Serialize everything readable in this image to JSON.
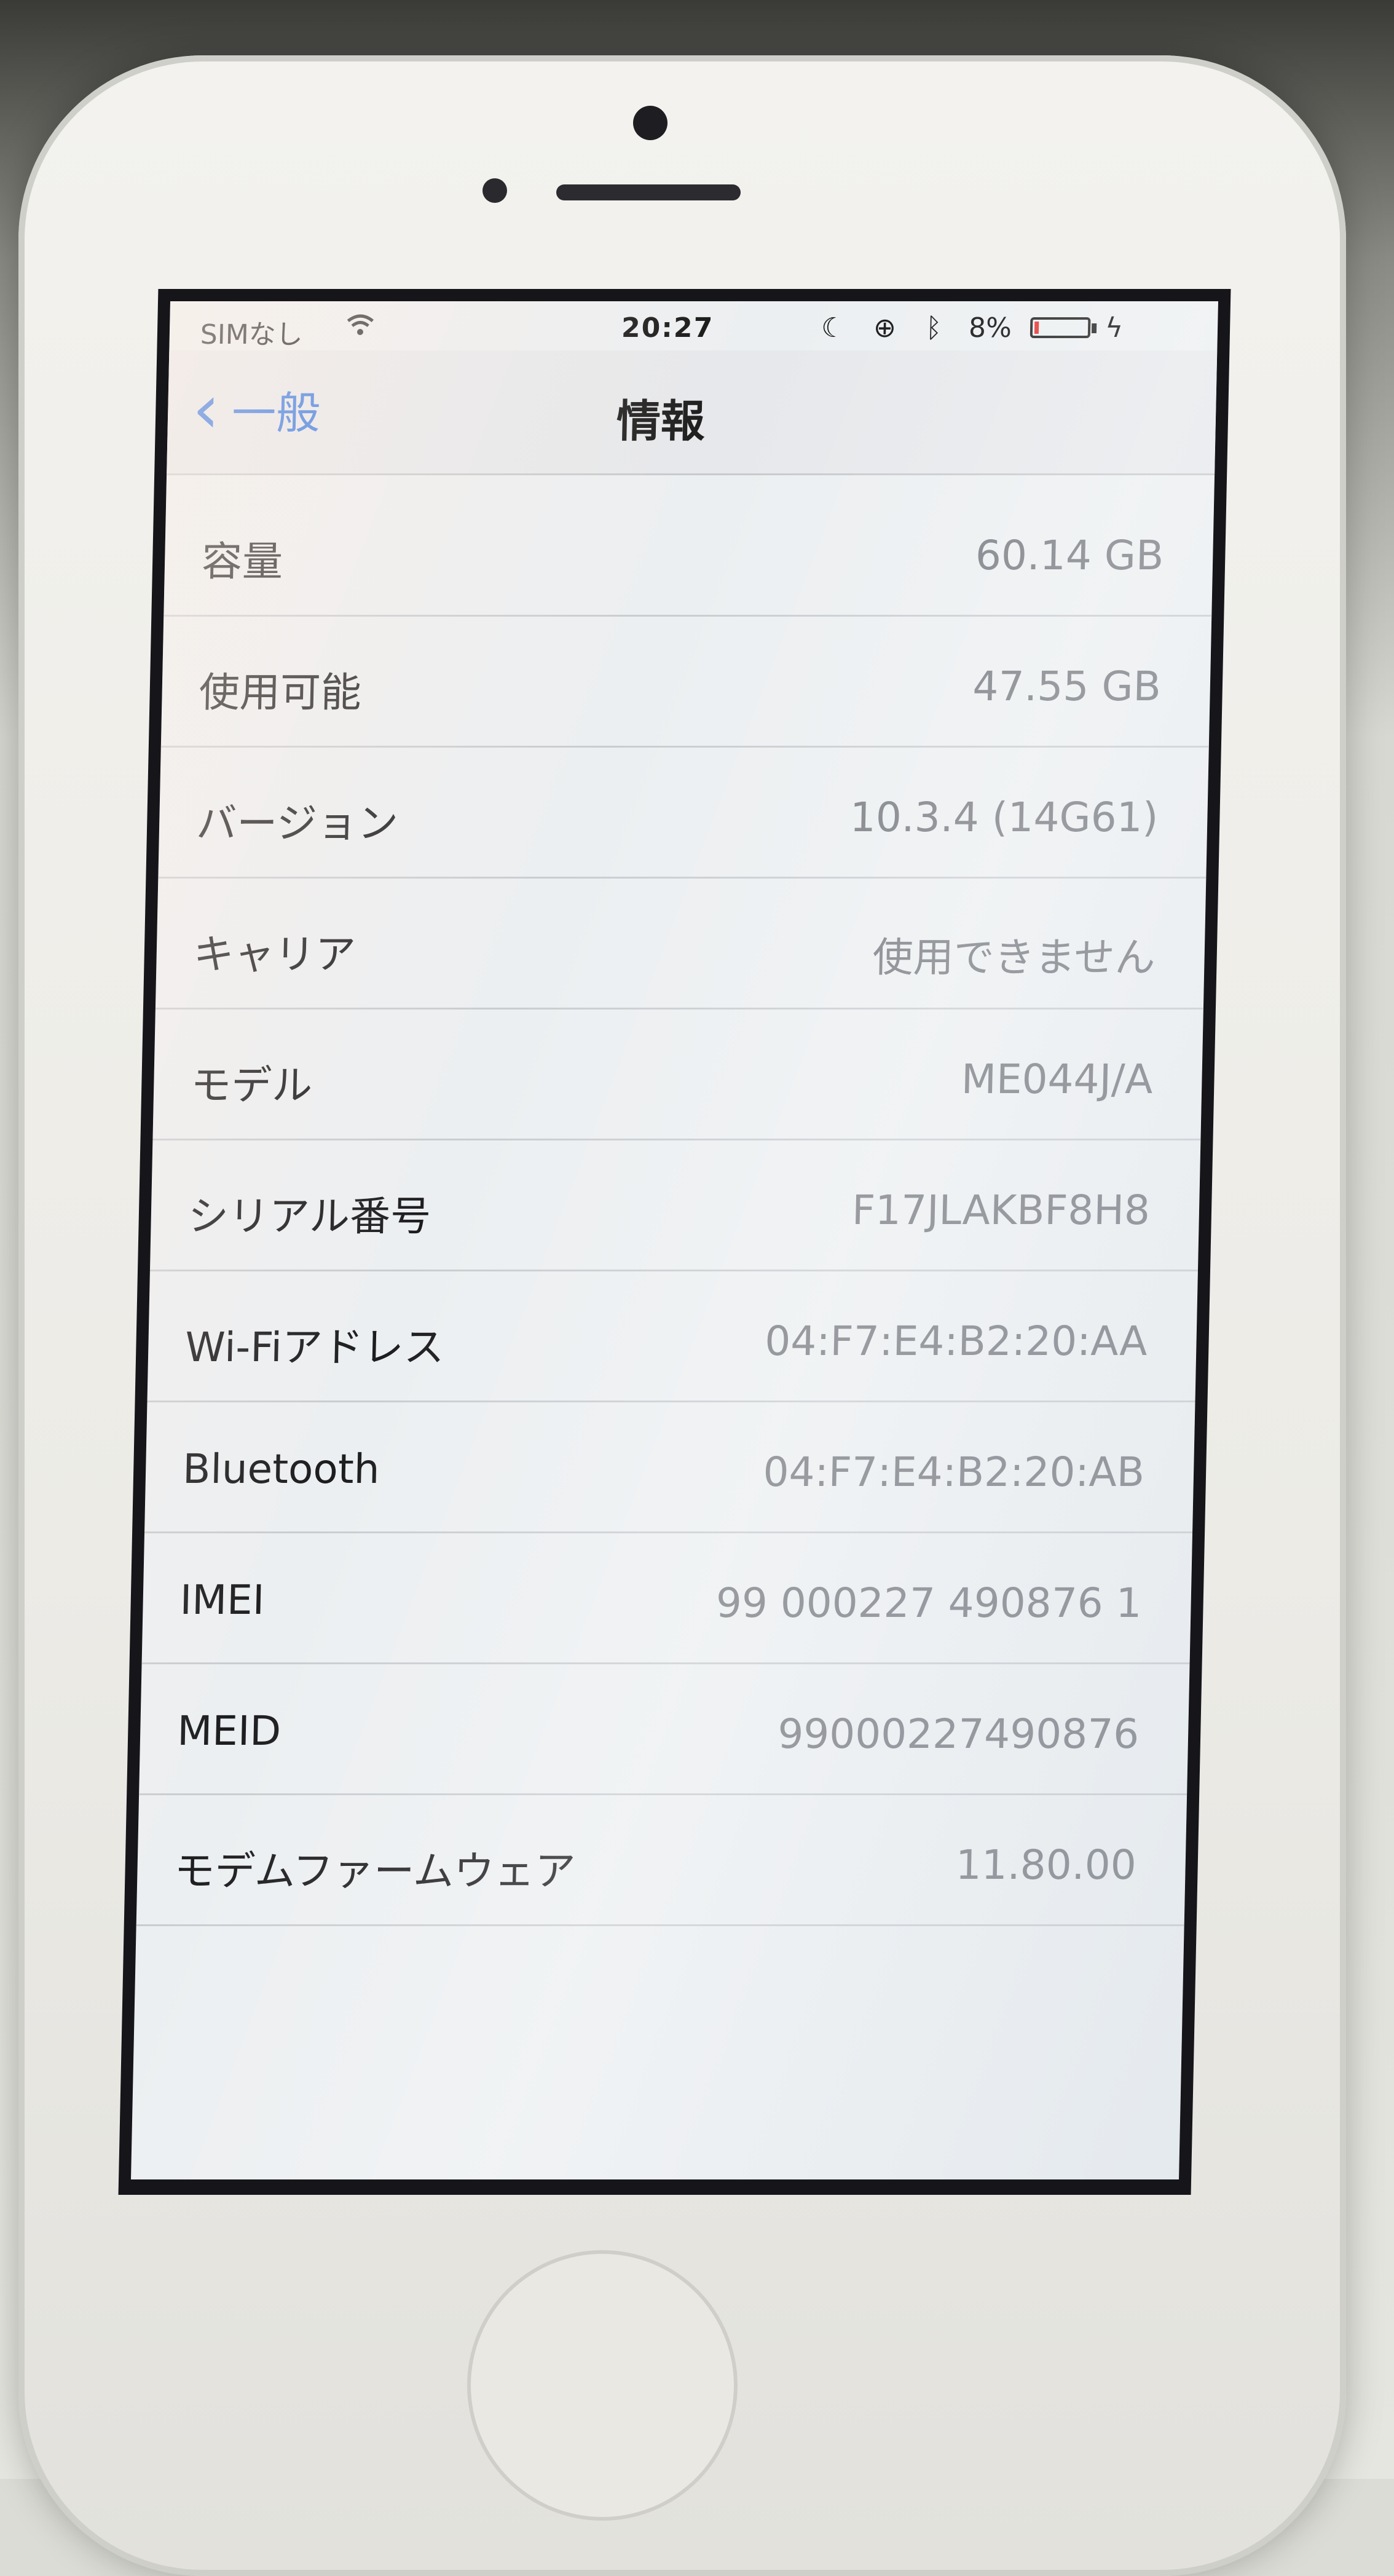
{
  "status_bar": {
    "carrier": "SIMなし",
    "time": "20:27",
    "battery_percent": "8%",
    "battery_level": 0.08,
    "icons": [
      "wifi-icon",
      "moon-icon",
      "rotation-lock-icon",
      "bluetooth-icon",
      "battery-icon",
      "charging-icon"
    ]
  },
  "nav": {
    "back_label": "一般",
    "title": "情報"
  },
  "rows": [
    {
      "label": "容量",
      "value": "60.14 GB"
    },
    {
      "label": "使用可能",
      "value": "47.55 GB"
    },
    {
      "label": "バージョン",
      "value": "10.3.4 (14G61)"
    },
    {
      "label": "キャリア",
      "value": "使用できません"
    },
    {
      "label": "モデル",
      "value": "ME044J/A"
    },
    {
      "label": "シリアル番号",
      "value": "F17JLAKBF8H8"
    },
    {
      "label": "Wi-Fiアドレス",
      "value": "04:F7:E4:B2:20:AA"
    },
    {
      "label": "Bluetooth",
      "value": "04:F7:E4:B2:20:AB"
    },
    {
      "label": "IMEI",
      "value": "99 000227 490876 1"
    },
    {
      "label": "MEID",
      "value": "99000227490876"
    },
    {
      "label": "モデムファームウェア",
      "value": "11.80.00"
    }
  ],
  "colors": {
    "accent": "#2a6fe0",
    "value_text": "#777a80",
    "battery_low": "#e33333"
  }
}
